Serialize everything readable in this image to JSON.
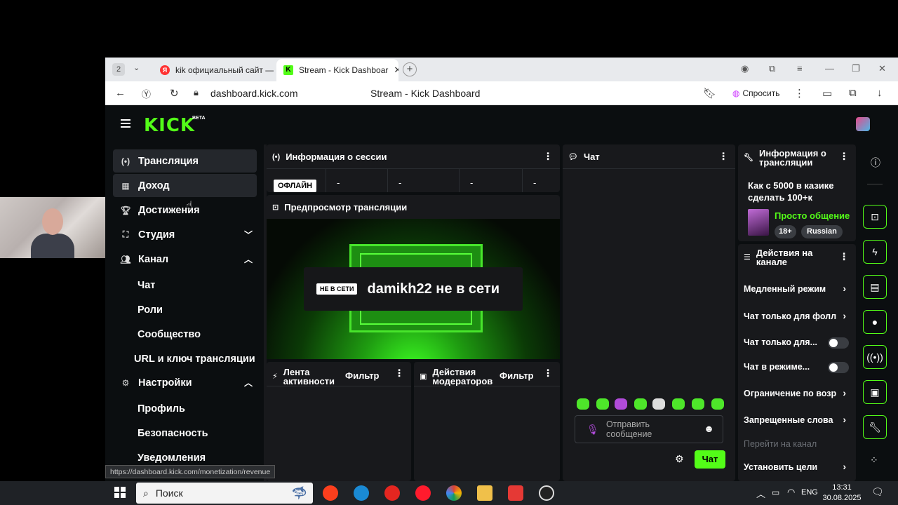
{
  "browser": {
    "tab_count": "2",
    "tabs": [
      {
        "label": "kik официальный сайт — ",
        "favicon": "Я"
      },
      {
        "label": "Stream - Kick Dashboar",
        "favicon": "K"
      }
    ],
    "url": "dashboard.kick.com",
    "page_title": "Stream - Kick Dashboard",
    "ask_label": "Спросить",
    "status_url": "https://dashboard.kick.com/monetization/revenue"
  },
  "app": {
    "logo": "KICK",
    "logo_badge": "BETA",
    "sidebar": {
      "items": [
        {
          "label": "Трансляция"
        },
        {
          "label": "Доход"
        },
        {
          "label": "Достижения"
        },
        {
          "label": "Студия"
        },
        {
          "label": "Канал"
        }
      ],
      "channel_sub": [
        "Чат",
        "Роли",
        "Сообщество",
        "URL и ключ трансляции"
      ],
      "settings_label": "Настройки",
      "settings_sub": [
        "Профиль",
        "Безопасность",
        "Уведомления"
      ]
    },
    "session": {
      "title": "Информация о сессии",
      "status_badge": "ОФЛАЙН",
      "stats": [
        "-",
        "-",
        "-",
        "-"
      ]
    },
    "preview": {
      "title": "Предпросмотр трансляции",
      "offline_badge": "НЕ В СЕТИ",
      "offline_text": "damikh22 не в сети"
    },
    "activity": {
      "title": "Лента активности",
      "filter": "Фильтр"
    },
    "modactions": {
      "title": "Действия модераторов",
      "filter": "Фильтр"
    },
    "chat": {
      "title": "Чат",
      "input_placeholder": "Отправить сообщение",
      "send_label": "Чат"
    },
    "stream_info": {
      "title": "Информация о трансляции",
      "stream_title": "Как с 5000 в казике сделать 100+к",
      "category": "Просто общение",
      "tags": [
        "18+",
        "Russian"
      ]
    },
    "channel_actions": {
      "title": "Действия на канале",
      "rows": [
        {
          "label": "Медленный режим",
          "type": "chevron"
        },
        {
          "label": "Чат только для фолл",
          "type": "chevron"
        },
        {
          "label": "Чат только для...",
          "type": "toggle"
        },
        {
          "label": "Чат в режиме...",
          "type": "toggle"
        },
        {
          "label": "Ограничение по возр",
          "type": "chevron"
        },
        {
          "label": "Запрещенные слова",
          "type": "chevron"
        },
        {
          "label": "Перейти на канал",
          "type": "disabled"
        },
        {
          "label": "Установить цели",
          "type": "chevron"
        }
      ]
    }
  },
  "taskbar": {
    "search_placeholder": "Поиск",
    "lang": "ENG",
    "time": "13:31",
    "date": "30.08.2025"
  },
  "colors": {
    "accent": "#53fc18",
    "panel": "#18191c",
    "bg": "#0b0e10"
  }
}
